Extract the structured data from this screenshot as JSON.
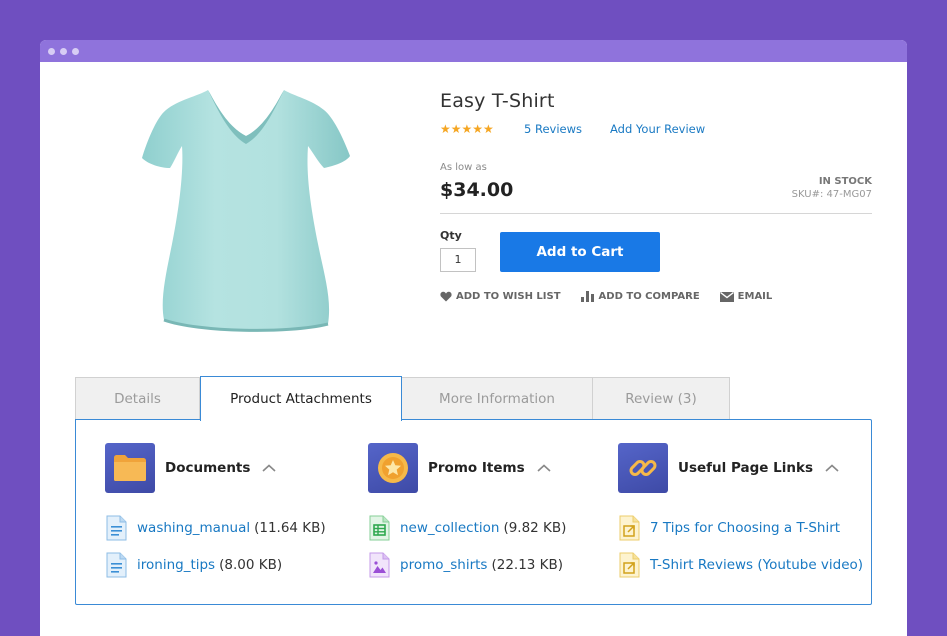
{
  "colors": {
    "background": "#6f4fc0",
    "titlebar": "#8f73dc",
    "accent": "#1979e6",
    "link": "#1979c3",
    "stars": "#f5a623"
  },
  "product": {
    "title": "Easy T-Shirt",
    "rating_stars": "★★★★★",
    "reviews_link": "5 Reviews",
    "add_review_link": "Add Your Review",
    "price_prefix": "As low as",
    "price": "$34.00",
    "stock_status": "IN STOCK",
    "sku": "SKU#: 47-MG07",
    "qty_label": "Qty",
    "qty_value": "1",
    "add_to_cart_label": "Add to Cart",
    "actions": [
      {
        "label": "ADD TO WISH LIST",
        "icon": "heart-icon"
      },
      {
        "label": "ADD TO COMPARE",
        "icon": "bar-chart-icon"
      },
      {
        "label": "EMAIL",
        "icon": "envelope-icon"
      }
    ]
  },
  "tabs": [
    {
      "label": "Details",
      "active": false
    },
    {
      "label": "Product Attachments",
      "active": true
    },
    {
      "label": "More Information",
      "active": false
    },
    {
      "label": "Review (3)",
      "active": false
    }
  ],
  "attachments": [
    {
      "title": "Documents",
      "icon": "folder-icon",
      "files": [
        {
          "name": "washing_manual",
          "size": "(11.64 KB)",
          "icon": "document-icon"
        },
        {
          "name": "ironing_tips",
          "size": "(8.00 KB)",
          "icon": "document-icon"
        }
      ]
    },
    {
      "title": "Promo Items",
      "icon": "star-badge-icon",
      "files": [
        {
          "name": "new_collection",
          "size": "(9.82 KB)",
          "icon": "spreadsheet-icon"
        },
        {
          "name": "promo_shirts",
          "size": "(22.13 KB)",
          "icon": "image-file-icon"
        }
      ]
    },
    {
      "title": "Useful Page Links",
      "icon": "link-icon",
      "files": [
        {
          "name": "7 Tips for Choosing a T-Shirt",
          "size": "",
          "icon": "external-link-file-icon"
        },
        {
          "name": "T-Shirt Reviews (Youtube video)",
          "size": "",
          "icon": "external-link-file-icon"
        }
      ]
    }
  ]
}
